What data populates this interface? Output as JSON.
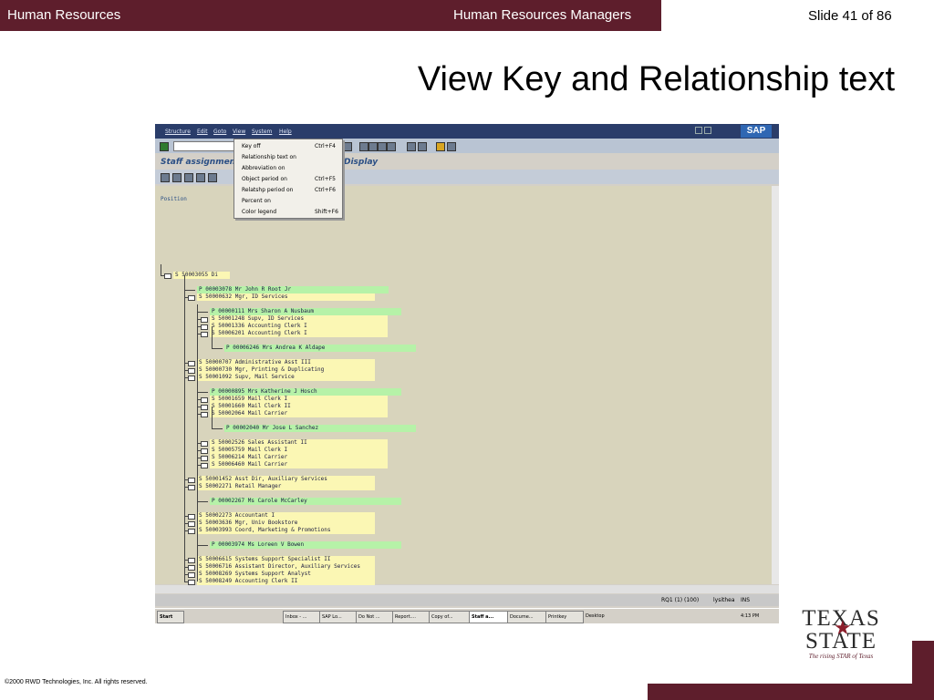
{
  "header": {
    "left_title": "Human Resources",
    "center_title": "Human Resources Managers",
    "slide_number": "Slide 41 of 86"
  },
  "slide_title": "View Key and Relationship text",
  "footer": {
    "copyright": "©2000 RWD Technologies, Inc.  All rights reserved."
  },
  "logo": {
    "line1": "TEXAS",
    "line2": "STATE",
    "tagline": "The rising STAR of Texas"
  },
  "sap": {
    "menu": [
      "Structure",
      "Edit",
      "Goto",
      "View",
      "System",
      "Help"
    ],
    "screen_title_left": "Staff assignments",
    "screen_title_right": "Display",
    "position_label": "Position",
    "view_menu": [
      {
        "label": "Key off",
        "shortcut": "Ctrl+F4"
      },
      {
        "label": "Relationship text on",
        "shortcut": ""
      },
      {
        "label": "Abbreviation on",
        "shortcut": ""
      },
      {
        "label": "Object period on",
        "shortcut": "Ctrl+F5"
      },
      {
        "label": "Relatshp period on",
        "shortcut": "Ctrl+F6"
      },
      {
        "label": "Percent on",
        "shortcut": ""
      },
      {
        "label": "Color legend",
        "shortcut": "Shift+F6"
      }
    ],
    "tree": [
      {
        "type": "S",
        "text": "S  50003055 Di",
        "level": 0
      },
      {
        "type": "P",
        "text": "P  00003078 Mr John R Root Jr",
        "level": 1
      },
      {
        "type": "S",
        "text": "S  50000632 Mgr, ID Services",
        "level": 1
      },
      {
        "type": "P",
        "text": "P  00000111 Mrs Sharon A Nusbaum",
        "level": 2
      },
      {
        "type": "S",
        "text": "S  50001248 Supv, ID Services",
        "level": 2
      },
      {
        "type": "S",
        "text": "S  50001336 Accounting Clerk I",
        "level": 2
      },
      {
        "type": "S",
        "text": "S  50006201 Accounting Clerk I",
        "level": 2
      },
      {
        "type": "P",
        "text": "P  00006246 Mrs Andrea K Aldape",
        "level": 3
      },
      {
        "type": "S",
        "text": "S  50000707 Administrative Asst III",
        "level": 1
      },
      {
        "type": "S",
        "text": "S  50000730 Mgr, Printing & Duplicating",
        "level": 1
      },
      {
        "type": "S",
        "text": "S  50001092 Supv, Mail Service",
        "level": 1
      },
      {
        "type": "P",
        "text": "P  00000895 Mrs Katherine J Hosch",
        "level": 2
      },
      {
        "type": "S",
        "text": "S  50001659 Mail Clerk I",
        "level": 2
      },
      {
        "type": "S",
        "text": "S  50001660 Mail Clerk II",
        "level": 2
      },
      {
        "type": "S",
        "text": "S  50002064 Mail Carrier",
        "level": 2
      },
      {
        "type": "P",
        "text": "P  00002040 Mr Jose L Sanchez",
        "level": 3
      },
      {
        "type": "S",
        "text": "S  50002526 Sales Assistant II",
        "level": 2
      },
      {
        "type": "S",
        "text": "S  50005759 Mail Clerk I",
        "level": 2
      },
      {
        "type": "S",
        "text": "S  50006214 Mail Carrier",
        "level": 2
      },
      {
        "type": "S",
        "text": "S  50006460 Mail Carrier",
        "level": 2
      },
      {
        "type": "S",
        "text": "S  50001452 Asst Dir, Auxiliary Services",
        "level": 1
      },
      {
        "type": "S",
        "text": "S  50002271 Retail Manager",
        "level": 1
      },
      {
        "type": "P",
        "text": "P  00002267 Ms Carole McCarley",
        "level": 2
      },
      {
        "type": "S",
        "text": "S  50002273 Accountant I",
        "level": 1
      },
      {
        "type": "S",
        "text": "S  50003636 Mgr, Univ Bookstore",
        "level": 1
      },
      {
        "type": "S",
        "text": "S  50003993 Coord, Marketing & Promotions",
        "level": 1
      },
      {
        "type": "P",
        "text": "P  00003974 Ms Loreen V Bowen",
        "level": 2
      },
      {
        "type": "S",
        "text": "S  50006615 Systems Support Specialist II",
        "level": 1
      },
      {
        "type": "S",
        "text": "S  50006716 Assistant Director, Auxiliary Services",
        "level": 1
      },
      {
        "type": "S",
        "text": "S  50008269 Systems Support Analyst",
        "level": 1
      },
      {
        "type": "S",
        "text": "S  50008249 Accounting Clerk II",
        "level": 1
      }
    ],
    "status": {
      "system": "RQ1 (1) (100)",
      "user": "lysithea",
      "mode": "INS"
    },
    "taskbar": {
      "start": "Start",
      "items": [
        "Inbox - ...",
        "SAP Lo...",
        "Do Not ...",
        "Report....",
        "Copy of...",
        "Staff a...",
        "Docume...",
        "Printkey"
      ],
      "desktop": "Desktop",
      "clock": "4:13 PM"
    }
  }
}
